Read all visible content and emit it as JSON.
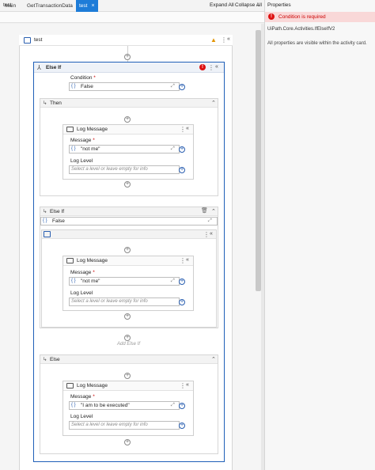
{
  "tabs": [
    {
      "label": "Main"
    },
    {
      "label": "GetTransactionData"
    },
    {
      "label": "test",
      "close": "×"
    }
  ],
  "tab_overflow": "⌄",
  "breadcrumb": "test",
  "toolbar": {
    "expand_all": "Expand All",
    "collapse_all": "Collapse All"
  },
  "sequence": {
    "title": "test"
  },
  "else_if": {
    "title": "Else If",
    "condition_label": "Condition",
    "required_mark": "*",
    "condition_value": "False",
    "then": {
      "title": "Then",
      "log": {
        "title": "Log Message",
        "message_label": "Message",
        "message_value": "\"not me\"",
        "level_label": "Log Level",
        "level_placeholder": "Select a level or leave empty for info"
      }
    },
    "else_if_branch": {
      "title": "Else If",
      "condition_value": "False",
      "log": {
        "title": "Log Message",
        "message_label": "Message",
        "message_value": "\"not me\"",
        "level_label": "Log Level",
        "level_placeholder": "Select a level or leave empty for info"
      }
    },
    "add_else_if": "Add Else If",
    "else": {
      "title": "Else",
      "log": {
        "title": "Log Message",
        "message_label": "Message",
        "message_value": "\"I am to be executed\"",
        "level_label": "Log Level",
        "level_placeholder": "Select a level or leave empty for info"
      }
    }
  },
  "properties": {
    "title": "Properties",
    "error": "Condition is required",
    "activity_type": "UiPath.Core.Activities.IfElseIfV2",
    "note": "All properties are visible within the activity card."
  },
  "glyphs": {
    "plus": "+",
    "kebab": "⋮",
    "collapse": "«",
    "brace": "{ }",
    "expand": "⤢",
    "arrow": "↳",
    "warning": "▲",
    "error": "!",
    "trash": "🗑",
    "chevron_up": "⌃"
  },
  "colors": {
    "accent": "#1e7cd8",
    "error": "#dd1111",
    "warning": "#e39500",
    "selection_border": "#1f5fb8"
  }
}
